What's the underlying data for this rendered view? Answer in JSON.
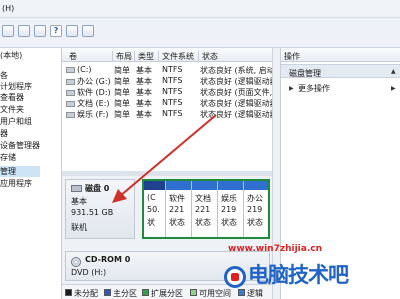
{
  "menubar": {
    "help": "(H)"
  },
  "sidebar": {
    "items": [
      {
        "label": "(本地)"
      },
      {
        "label": "各"
      },
      {
        "label": "计划程序"
      },
      {
        "label": "查看器"
      },
      {
        "label": "文件夹"
      },
      {
        "label": "用户和组"
      },
      {
        "label": "器"
      },
      {
        "label": "设备管理器"
      },
      {
        "label": "存储"
      },
      {
        "label": "管理"
      },
      {
        "label": "应用程序"
      }
    ]
  },
  "volume_list": {
    "headers": [
      "卷",
      "布局",
      "类型",
      "文件系统",
      "状态"
    ],
    "rows": [
      {
        "vol": "(C:)",
        "layout": "简单",
        "type": "基本",
        "fs": "NTFS",
        "status": "状态良好 (系统, 启动, 页"
      },
      {
        "vol": "办公 (G:)",
        "layout": "简单",
        "type": "基本",
        "fs": "NTFS",
        "status": "状态良好 (逻辑驱动器)"
      },
      {
        "vol": "软件 (D:)",
        "layout": "简单",
        "type": "基本",
        "fs": "NTFS",
        "status": "状态良好 (页面文件, 逻"
      },
      {
        "vol": "文档 (E:)",
        "layout": "简单",
        "type": "基本",
        "fs": "NTFS",
        "status": "状态良好 (逻辑驱动器)"
      },
      {
        "vol": "娱乐 (F:)",
        "layout": "简单",
        "type": "基本",
        "fs": "NTFS",
        "status": "状态良好 (逻辑驱动器)"
      }
    ]
  },
  "disk0": {
    "name": "磁盘 0",
    "type": "基本",
    "size": "931.51 GB",
    "state": "联机",
    "partitions": [
      {
        "label": "(C",
        "size": "50.",
        "state": "状"
      },
      {
        "label": "软件",
        "size": "221",
        "state": "状态"
      },
      {
        "label": "文档",
        "size": "221",
        "state": "状态"
      },
      {
        "label": "娱乐",
        "size": "219",
        "state": "状态"
      },
      {
        "label": "办公",
        "size": "219",
        "state": "状态"
      }
    ]
  },
  "cdrom": {
    "name": "CD-ROM 0",
    "type": "DVD (H:)"
  },
  "legend": [
    {
      "label": "未分配",
      "color": "#1a1a1a"
    },
    {
      "label": "主分区",
      "color": "#2d5bb8"
    },
    {
      "label": "扩展分区",
      "color": "#2ea34a"
    },
    {
      "label": "可用空间",
      "color": "#8fd18b"
    },
    {
      "label": "逻辑",
      "color": "#3a7bd5"
    }
  ],
  "actions": {
    "header": "操作",
    "section": "磁盘管理",
    "more": "更多操作"
  },
  "watermark": {
    "url": "www.win7zhijia.cn",
    "brand": "电脑技术吧"
  },
  "colors": {
    "arrow": "#d0302a",
    "primary_bar": "#1f3f8f",
    "logical_bar": "#2f6fd0",
    "extended_border": "#1e8a3a"
  }
}
